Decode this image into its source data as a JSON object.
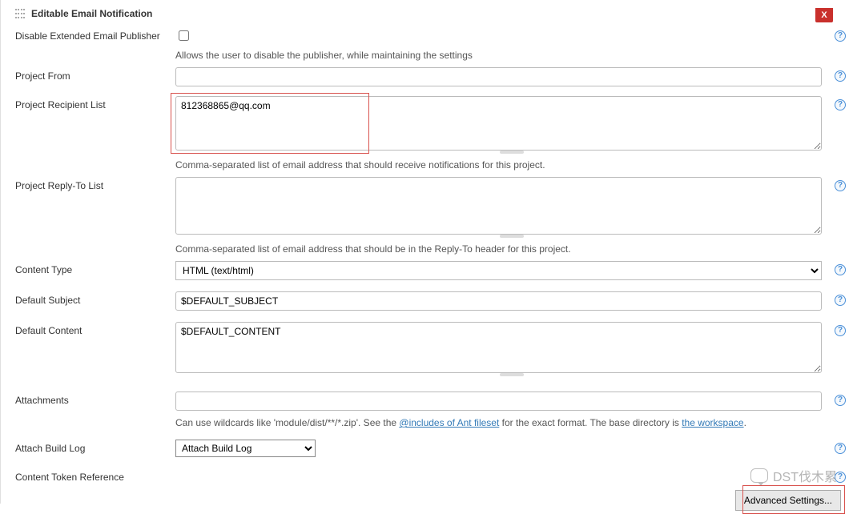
{
  "header": {
    "title": "Editable Email Notification",
    "close_label": "X"
  },
  "fields": {
    "disable_ext": {
      "label": "Disable Extended Email Publisher",
      "checked": false,
      "help": "Allows the user to disable the publisher, while maintaining the settings"
    },
    "project_from": {
      "label": "Project From",
      "value": ""
    },
    "recipient_list": {
      "label": "Project Recipient List",
      "value": "812368865@qq.com",
      "help": "Comma-separated list of email address that should receive notifications for this project."
    },
    "reply_to": {
      "label": "Project Reply-To List",
      "value": "",
      "help": "Comma-separated list of email address that should be in the Reply-To header for this project."
    },
    "content_type": {
      "label": "Content Type",
      "value": "HTML (text/html)"
    },
    "default_subject": {
      "label": "Default Subject",
      "value": "$DEFAULT_SUBJECT"
    },
    "default_content": {
      "label": "Default Content",
      "value": "$DEFAULT_CONTENT"
    },
    "attachments": {
      "label": "Attachments",
      "value": "",
      "help_pre": "Can use wildcards like 'module/dist/**/*.zip'. See the ",
      "help_link1": "@includes of Ant fileset",
      "help_mid": " for the exact format. The base directory is ",
      "help_link2": "the workspace",
      "help_post": "."
    },
    "attach_log": {
      "label": "Attach Build Log",
      "value": "Attach Build Log"
    },
    "token_ref": {
      "label": "Content Token Reference"
    }
  },
  "buttons": {
    "advanced": "Advanced Settings..."
  },
  "watermark": "DST伐木累"
}
